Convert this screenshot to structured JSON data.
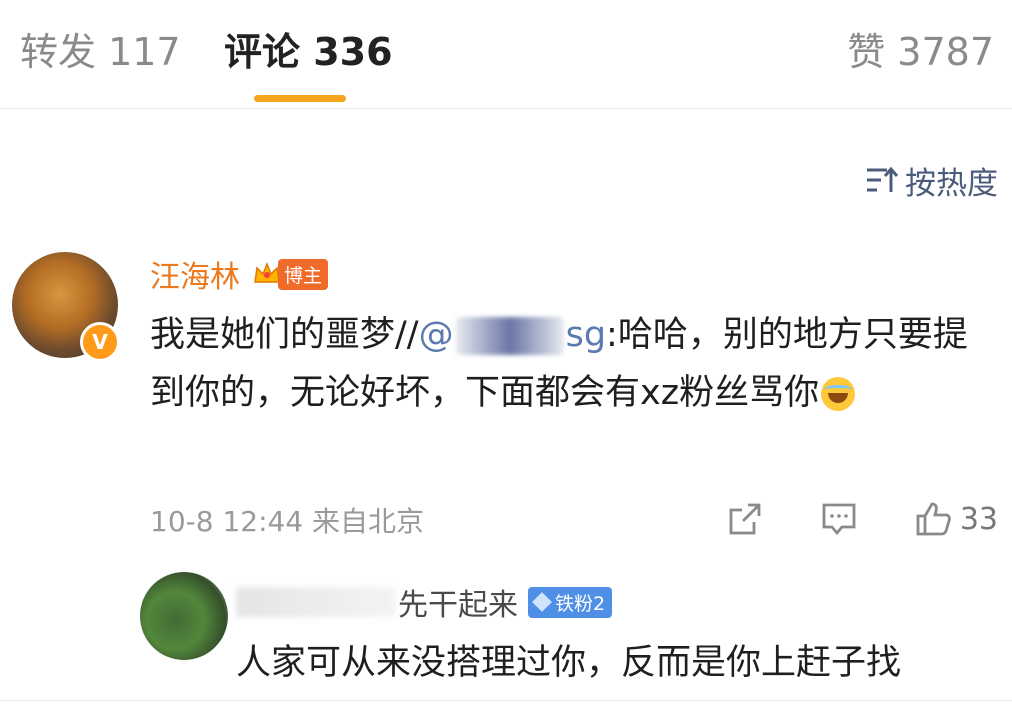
{
  "tabs": {
    "reposts": "转发 117",
    "comments": "评论 336",
    "likes": "赞 3787"
  },
  "sort": {
    "label": "按热度",
    "icon": "sort-icon"
  },
  "comment": {
    "username": "汪海林",
    "badge": "博主",
    "text_before": "我是她们的噩梦//",
    "mention_prefix": "@",
    "mention_suffix": "sg",
    "text_after": ":哈哈，别的地方只要提到你的，无论好坏，下面都会有xz粉丝骂你",
    "timestamp": "10-8 12:44",
    "location": "来自北京",
    "like_count": "33"
  },
  "reply": {
    "username_visible": "先干起来",
    "badge": "铁粉2",
    "text": "人家可从来没搭理过你，反而是你上赶子找"
  },
  "colors": {
    "accent": "#f7a51d",
    "username": "#ec7a1d",
    "mention": "#5a7ab0",
    "fan_badge": "#4f8fe6"
  }
}
